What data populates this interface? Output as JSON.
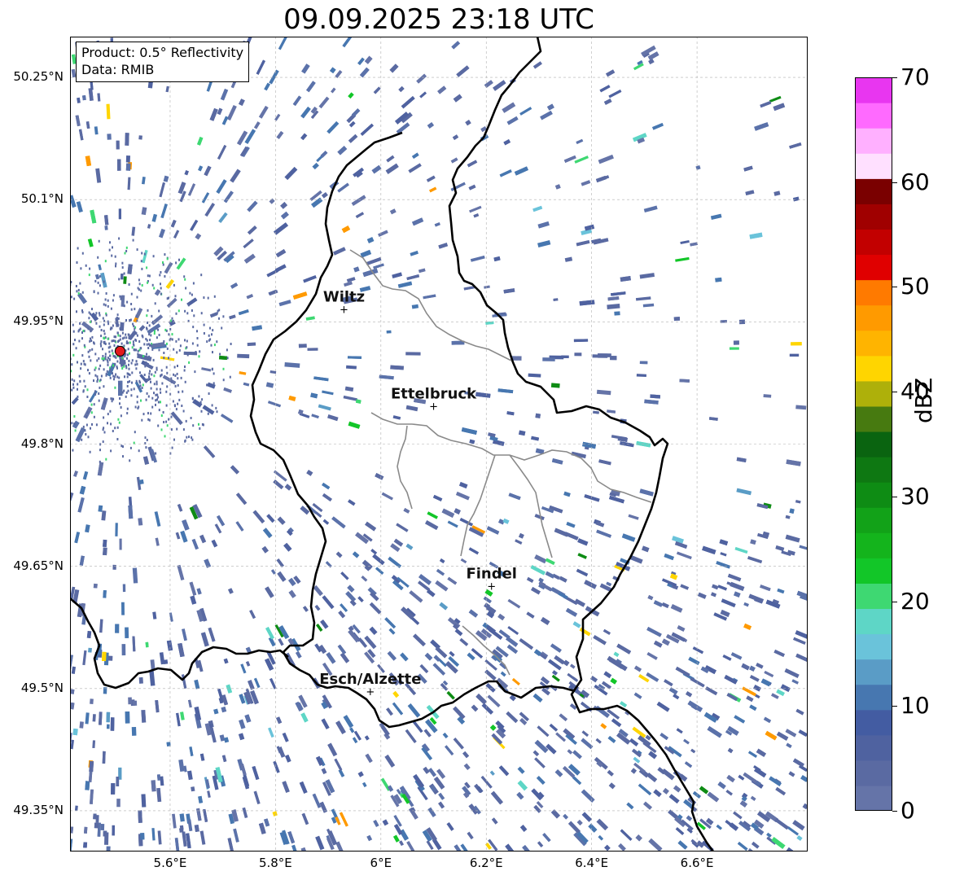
{
  "title": "09.09.2025 23:18 UTC",
  "info_box": {
    "product_line": "Product: 0.5° Reflectivity",
    "data_line": "Data: RMIB"
  },
  "axes": {
    "lon_labels": [
      "5.6°E",
      "5.8°E",
      "6°E",
      "6.2°E",
      "6.4°E",
      "6.6°E"
    ],
    "lat_labels": [
      "50.25°N",
      "50.1°N",
      "49.95°N",
      "49.8°N",
      "49.65°N",
      "49.5°N",
      "49.35°N"
    ],
    "lon_range": [
      5.41,
      6.81
    ],
    "lat_range": [
      49.3,
      50.3
    ],
    "grid": true
  },
  "cities": [
    {
      "name": "Wiltz",
      "lon": 5.93,
      "lat": 49.966
    },
    {
      "name": "Ettelbruck",
      "lon": 6.1,
      "lat": 49.847
    },
    {
      "name": "Findel",
      "lon": 6.21,
      "lat": 49.626
    },
    {
      "name": "Esch/Alzette",
      "lon": 5.98,
      "lat": 49.497
    }
  ],
  "radar_site": {
    "lon": 5.505,
    "lat": 49.914,
    "color": "#e31a1c"
  },
  "colorbar": {
    "label": "dBZ",
    "min": 0,
    "max": 70,
    "ticks": [
      "0",
      "10",
      "20",
      "30",
      "40",
      "50",
      "60",
      "70"
    ],
    "colors": [
      "#6574a8",
      "#5a6aa2",
      "#4f62a0",
      "#435ca2",
      "#4777b0",
      "#5a9cc6",
      "#6ac3da",
      "#5ed6c6",
      "#3ed872",
      "#12c628",
      "#14b41c",
      "#12a218",
      "#0e8c14",
      "#0e7812",
      "#0a6410",
      "#477a10",
      "#aeb00a",
      "#ffd500",
      "#ffb400",
      "#ff9a00",
      "#ff7a00",
      "#e00000",
      "#c20000",
      "#a00000",
      "#7a0000",
      "#ffe0ff",
      "#ffb0ff",
      "#ff6aff",
      "#e836f0"
    ]
  }
}
